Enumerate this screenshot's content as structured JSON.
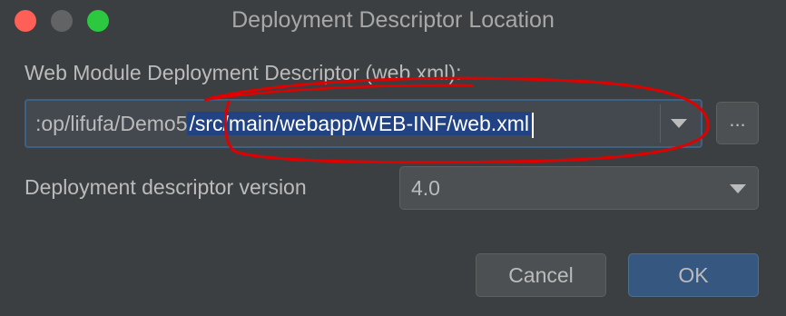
{
  "window": {
    "title": "Deployment Descriptor Location"
  },
  "descriptor": {
    "label": "Web Module Deployment Descriptor (web.xml):",
    "path_visible_prefix": ":op/lifufa/Demo5",
    "path_selected": "/src/main/webapp/WEB-INF/web.xml",
    "browse_label": "..."
  },
  "version": {
    "label": "Deployment descriptor version",
    "value": "4.0"
  },
  "buttons": {
    "cancel": "Cancel",
    "ok": "OK"
  },
  "colors": {
    "background": "#3c3f41",
    "selection": "#214283",
    "annotation": "#e00000",
    "primary_button": "#365880"
  }
}
